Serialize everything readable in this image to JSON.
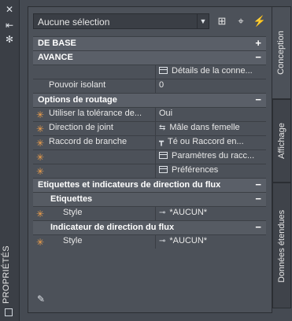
{
  "palette": {
    "bg": "#454a52",
    "panel": "#4c5159",
    "header": "#5a5f68",
    "accent_star": "#f1a04b"
  },
  "left_bar": {
    "vertical_title": "PROPRIÉTÉS",
    "top_icons": [
      "close-icon",
      "pin-icon",
      "gear-icon"
    ]
  },
  "selection": {
    "dropdown_value": "Aucune sélection",
    "tools": [
      "add-selection-icon",
      "select-objects-icon",
      "quick-select-icon"
    ]
  },
  "tabs": {
    "conception": "Conception",
    "affichage": "Affichage",
    "donnees": "Données étendues"
  },
  "grid": {
    "sections": [
      {
        "title": "DE BASE",
        "toggle": "+"
      },
      {
        "title": "AVANCE",
        "toggle": "−"
      }
    ],
    "avance_rows": [
      {
        "name": "",
        "value": "Détails de la conne..."
      },
      {
        "name": "Pouvoir isolant",
        "value": "0"
      }
    ],
    "routage": {
      "title": "Options de routage",
      "toggle": "−",
      "rows": [
        {
          "name": "Utiliser la tolérance de...",
          "value": "Oui"
        },
        {
          "name": "Direction de joint",
          "value": "Mâle dans femelle"
        },
        {
          "name": "Raccord de branche",
          "value": "Té ou Raccord en..."
        },
        {
          "name": "",
          "value": "Paramètres du racc..."
        },
        {
          "name": "",
          "value": "Préférences"
        }
      ]
    },
    "etiquettes_section": {
      "title": "Etiquettes et indicateurs de direction du flux",
      "toggle": "−",
      "subs": [
        {
          "title": "Etiquettes",
          "toggle": "−",
          "row": {
            "name": "Style",
            "value": "*AUCUN*"
          }
        },
        {
          "title": "Indicateur de direction du flux",
          "toggle": "−",
          "row": {
            "name": "Style",
            "value": "*AUCUN*"
          }
        }
      ]
    }
  }
}
